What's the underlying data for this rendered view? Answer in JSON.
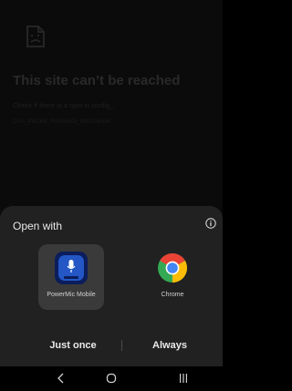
{
  "background_page": {
    "title": "This site can’t be reached",
    "subtitle": "Check if there is a typo in config_.",
    "error_code": "DNS_PROBE_FINISHED_NXDOMAIN",
    "icon": "sad-document-icon"
  },
  "sheet": {
    "title": "Open with",
    "info_icon": "info-icon",
    "apps": [
      {
        "label": "PowerMic Mobile",
        "icon": "powermic-app-icon",
        "selected": true
      },
      {
        "label": "Chrome",
        "icon": "chrome-app-icon",
        "selected": false
      }
    ],
    "buttons": {
      "just_once": "Just once",
      "always": "Always"
    }
  },
  "navbar": {
    "back": "back-icon",
    "home": "home-icon",
    "recents": "recents-icon"
  }
}
